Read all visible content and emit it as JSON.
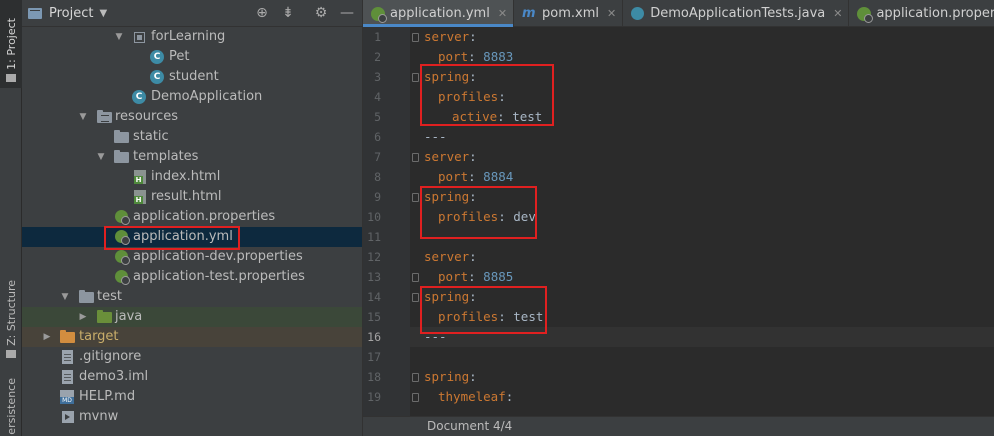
{
  "tool_strip": {
    "project_tab": "1: Project",
    "structure_tab": "Z: Structure",
    "persistence_tab": "ersistence"
  },
  "project_panel": {
    "title": "Project",
    "dropdown_icon": "caret-down-icon",
    "buttons": [
      "target-icon",
      "collapse-icon",
      "gear-icon",
      "hide-icon"
    ]
  },
  "tree": {
    "items": [
      {
        "label": "forLearning"
      },
      {
        "label": "Pet"
      },
      {
        "label": "student"
      },
      {
        "label": "DemoApplication"
      },
      {
        "label": "resources"
      },
      {
        "label": "static"
      },
      {
        "label": "templates"
      },
      {
        "label": "index.html"
      },
      {
        "label": "result.html"
      },
      {
        "label": "application.properties"
      },
      {
        "label": "application.yml"
      },
      {
        "label": "application-dev.properties"
      },
      {
        "label": "application-test.properties"
      },
      {
        "label": "test"
      },
      {
        "label": "java"
      },
      {
        "label": "target"
      },
      {
        "label": ".gitignore"
      },
      {
        "label": "demo3.iml"
      },
      {
        "label": "HELP.md"
      },
      {
        "label": "mvnw"
      }
    ]
  },
  "tabs": [
    {
      "label": "application.yml",
      "icon": "spring-icon"
    },
    {
      "label": "pom.xml",
      "icon": "maven-icon"
    },
    {
      "label": "DemoApplicationTests.java",
      "icon": "class-icon"
    },
    {
      "label": "application.properties",
      "icon": "spring-icon"
    }
  ],
  "editor": {
    "line_numbers": [
      "1",
      "2",
      "3",
      "4",
      "5",
      "6",
      "7",
      "8",
      "9",
      "10",
      "11",
      "12",
      "13",
      "14",
      "15",
      "16",
      "17",
      "18",
      "19"
    ],
    "current_line": "16",
    "lines": {
      "l1": {
        "key": "server",
        "colon": ":"
      },
      "l2": {
        "key": "port",
        "colon": ": ",
        "value": "8883"
      },
      "l3": {
        "key": "spring",
        "colon": ":"
      },
      "l4": {
        "key": "profiles",
        "colon": ":"
      },
      "l5": {
        "key": "active",
        "colon": ": ",
        "value": "test"
      },
      "l6": {
        "text": "---"
      },
      "l7": {
        "key": "server",
        "colon": ":"
      },
      "l8": {
        "key": "port",
        "colon": ": ",
        "value": "8884"
      },
      "l9": {
        "key": "spring",
        "colon": ":"
      },
      "l10": {
        "key": "profiles",
        "colon": ": ",
        "value": "dev"
      },
      "l12": {
        "key": "server",
        "colon": ":"
      },
      "l13": {
        "key": "port",
        "colon": ": ",
        "value": "8885"
      },
      "l14": {
        "key": "spring",
        "colon": ":"
      },
      "l15": {
        "key": "profiles",
        "colon": ": ",
        "value": "test"
      },
      "l16": {
        "text": "---"
      },
      "l18": {
        "key": "spring",
        "colon": ":"
      },
      "l19": {
        "key": "thymeleaf",
        "colon": ":"
      }
    }
  },
  "status": {
    "document": "Document 4/4"
  },
  "colors": {
    "highlight_box": "#e02020",
    "yaml_key": "#cc7832",
    "yaml_number": "#6897bb",
    "selection": "#0d293e"
  }
}
